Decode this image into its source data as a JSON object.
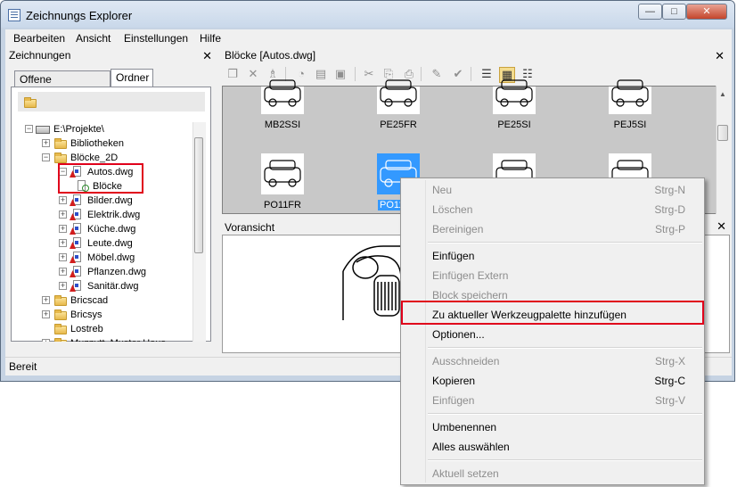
{
  "window": {
    "title": "Zeichnungs Explorer"
  },
  "menubar": [
    "Bearbeiten",
    "Ansicht",
    "Einstellungen",
    "Hilfe"
  ],
  "left_panel": {
    "title": "Zeichnungen",
    "tabs": [
      "Offene Zeichnungen",
      "Ordner"
    ],
    "active_tab": "Ordner",
    "tree": [
      {
        "label": "E:\\Projekte\\",
        "depth": 0,
        "kind": "drive",
        "expander": "−"
      },
      {
        "label": "Bibliotheken",
        "depth": 1,
        "kind": "folder",
        "expander": "+"
      },
      {
        "label": "Blöcke_2D",
        "depth": 1,
        "kind": "folder",
        "expander": "−"
      },
      {
        "label": "Autos.dwg",
        "depth": 2,
        "kind": "dwg",
        "expander": "−"
      },
      {
        "label": "Blöcke",
        "depth": 3,
        "kind": "blocks",
        "expander": ""
      },
      {
        "label": "Bilder.dwg",
        "depth": 2,
        "kind": "dwg",
        "expander": "+"
      },
      {
        "label": "Elektrik.dwg",
        "depth": 2,
        "kind": "dwg",
        "expander": "+"
      },
      {
        "label": "Küche.dwg",
        "depth": 2,
        "kind": "dwg",
        "expander": "+"
      },
      {
        "label": "Leute.dwg",
        "depth": 2,
        "kind": "dwg",
        "expander": "+"
      },
      {
        "label": "Möbel.dwg",
        "depth": 2,
        "kind": "dwg",
        "expander": "+"
      },
      {
        "label": "Pflanzen.dwg",
        "depth": 2,
        "kind": "dwg",
        "expander": "+"
      },
      {
        "label": "Sanitär.dwg",
        "depth": 2,
        "kind": "dwg",
        "expander": "+"
      },
      {
        "label": "Bricscad",
        "depth": 1,
        "kind": "folder",
        "expander": "+"
      },
      {
        "label": "Bricsys",
        "depth": 1,
        "kind": "folder",
        "expander": "+"
      },
      {
        "label": "Lostreb",
        "depth": 1,
        "kind": "folder",
        "expander": ""
      },
      {
        "label": "Muzzutt_Muster Haus",
        "depth": 1,
        "kind": "folder",
        "expander": "+"
      }
    ]
  },
  "right_panel": {
    "title": "Blöcke [Autos.dwg]",
    "blocks": [
      {
        "label": "MB2SSI",
        "selected": false
      },
      {
        "label": "PE25FR",
        "selected": false
      },
      {
        "label": "PE25SI",
        "selected": false
      },
      {
        "label": "PEJ5SI",
        "selected": false
      },
      {
        "label": "PO11FR",
        "selected": false
      },
      {
        "label": "PO11",
        "selected": true
      },
      {
        "label": "",
        "selected": false
      },
      {
        "label": "",
        "selected": false
      }
    ],
    "preview_title": "Voransicht"
  },
  "status": {
    "text": "Bereit"
  },
  "context_menu": {
    "groups": [
      [
        {
          "label": "Neu",
          "shortcut": "Strg-N",
          "enabled": false
        },
        {
          "label": "Löschen",
          "shortcut": "Strg-D",
          "enabled": false
        },
        {
          "label": "Bereinigen",
          "shortcut": "Strg-P",
          "enabled": false
        }
      ],
      [
        {
          "label": "Einfügen",
          "shortcut": "",
          "enabled": true
        },
        {
          "label": "Einfügen Extern",
          "shortcut": "",
          "enabled": false
        },
        {
          "label": "Block speichern",
          "shortcut": "",
          "enabled": false
        },
        {
          "label": "Zu aktueller Werkzeugpalette hinzufügen",
          "shortcut": "",
          "enabled": true,
          "highlighted": true
        },
        {
          "label": "Optionen...",
          "shortcut": "",
          "enabled": true
        }
      ],
      [
        {
          "label": "Ausschneiden",
          "shortcut": "Strg-X",
          "enabled": false
        },
        {
          "label": "Kopieren",
          "shortcut": "Strg-C",
          "enabled": true
        },
        {
          "label": "Einfügen",
          "shortcut": "Strg-V",
          "enabled": false
        }
      ],
      [
        {
          "label": "Umbenennen",
          "shortcut": "",
          "enabled": true
        },
        {
          "label": "Alles auswählen",
          "shortcut": "",
          "enabled": true
        }
      ],
      [
        {
          "label": "Aktuell setzen",
          "shortcut": "",
          "enabled": false
        }
      ]
    ]
  },
  "icons": {
    "caption": [
      "minimize-icon",
      "maximize-icon",
      "close-icon"
    ],
    "toolbar": [
      "new-block-icon",
      "delete-icon",
      "purge-icon",
      "insert-block-icon",
      "insert-external-icon",
      "save-block-icon",
      "cut-icon",
      "copy-icon",
      "paste-icon",
      "rename-icon",
      "set-current-icon",
      "list-view-icon",
      "large-icons-view-icon",
      "tree-view-icon"
    ]
  },
  "colors": {
    "highlight": "#e0001b",
    "selection": "#3399ff",
    "disabled_text": "#8d8d8d"
  }
}
